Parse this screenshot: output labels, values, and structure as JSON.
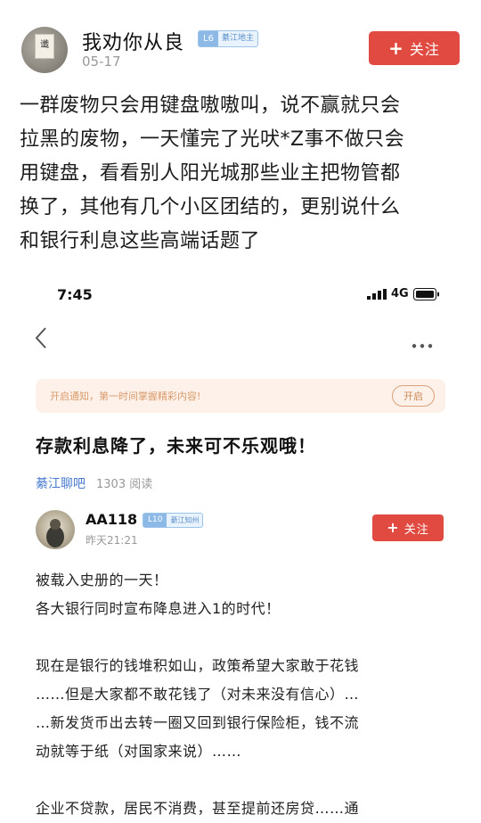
{
  "outer_post": {
    "author_name": "我劝你从良",
    "avatar_text": "谶",
    "level": "L6",
    "level_title": "綦江地主",
    "date": "05-17",
    "follow_label": "关注",
    "body_lines": [
      "一群废物只会用键盘嗷嗷叫，说不赢就只会",
      "拉黑的废物，一天懂完了光吠*Z事不做只会",
      "用键盘，看看别人阳光城那些业主把物管都",
      "换了，其他有几个小区团结的，更别说什么",
      "和银行利息这些高端话题了"
    ]
  },
  "screenshot": {
    "status_time": "7:45",
    "network": "4G",
    "back_icon": "chevron-left-icon",
    "more_icon": "more-dots-icon",
    "notice_text": "开启通知，第一时间掌握精彩内容!",
    "notice_button": "开启",
    "headline": "存款利息降了，未来可不乐观哦！",
    "source": "綦江聊吧",
    "reads": "1303 阅读",
    "author_name": "AA118",
    "level": "L10",
    "level_title": "綦江知州",
    "author_date": "昨天21:21",
    "follow_label": "关注",
    "paragraph1": [
      "被载入史册的一天！",
      "各大银行同时宣布降息进入1的时代！"
    ],
    "paragraph2": [
      "现在是银行的钱堆积如山，政策希望大家敢于花钱",
      "……但是大家都不敢花钱了（对未来没有信心）…",
      "…新发货币出去转一圈又回到银行保险柜，钱不流",
      "动就等于纸（对国家来说）……"
    ],
    "paragraph3": [
      "企业不贷款，居民不消费，甚至提前还房贷……通"
    ]
  },
  "colors": {
    "follow_red": "#e14a40",
    "source_blue": "#4a7bd0",
    "notice_bg": "#fdf1e9",
    "notice_text": "#d99a6a"
  }
}
